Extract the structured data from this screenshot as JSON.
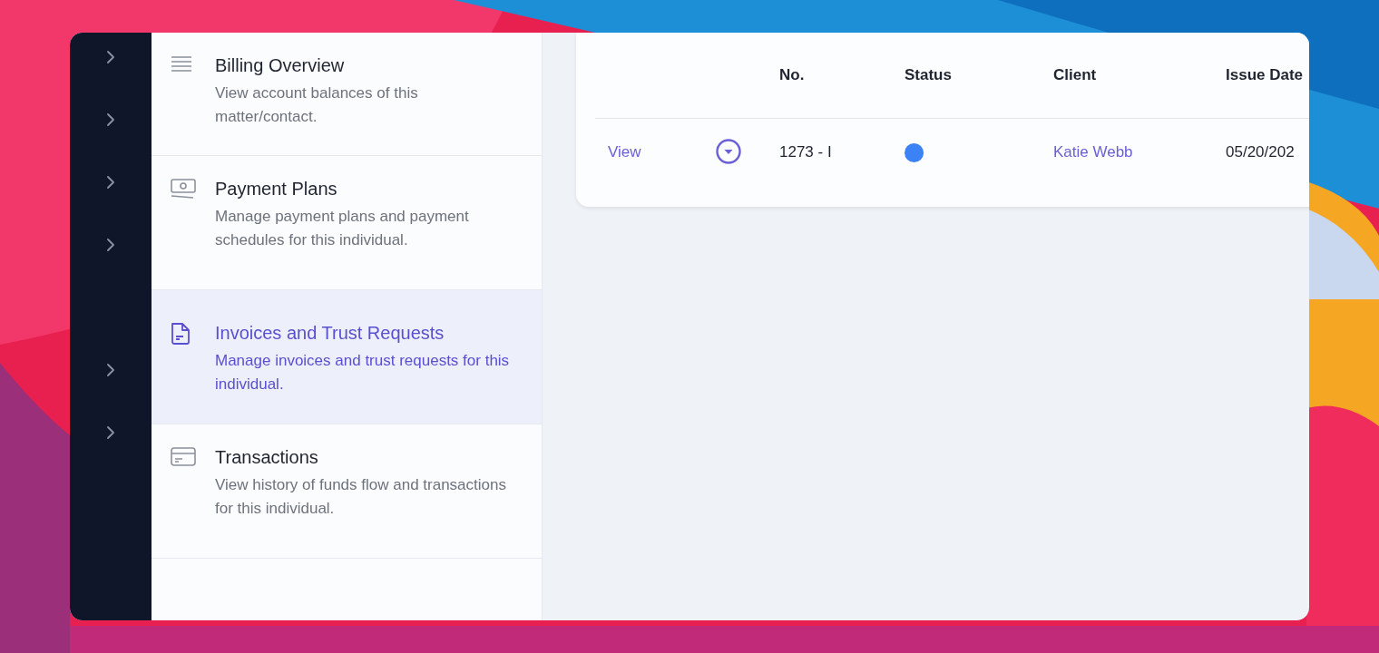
{
  "menu": [
    {
      "kind": "list",
      "title": "Billing Overview",
      "description": "View account balances of this matter/contact.",
      "selected": false
    },
    {
      "kind": "money",
      "title": "Payment Plans",
      "description": "Manage payment plans and payment schedules for this individual.",
      "selected": false
    },
    {
      "kind": "document",
      "title": "Invoices and Trust Requests",
      "description": "Manage invoices and trust requests for this individual.",
      "selected": true
    },
    {
      "kind": "card",
      "title": "Transactions",
      "description": "View history of funds flow and transactions for this individual.",
      "selected": false
    }
  ],
  "table": {
    "columns": [
      {},
      {},
      {
        "label": "No."
      },
      {
        "label": "Status"
      },
      {
        "label": "Client"
      },
      {
        "label": "Issue Date"
      }
    ],
    "rows": [
      {
        "action": "View",
        "number": "1273 - I",
        "color": "#3b82f6",
        "client": "Katie Webb",
        "issue_date": "05/20/202"
      }
    ]
  }
}
